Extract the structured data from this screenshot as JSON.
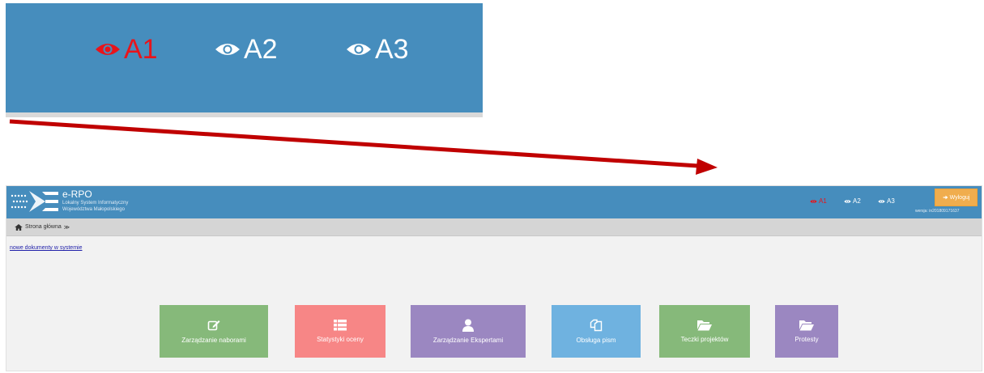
{
  "zoom_callout": {
    "accessibility_options": [
      {
        "label": "A1",
        "icon": "eye-icon",
        "active": true
      },
      {
        "label": "A2",
        "icon": "eye-icon",
        "active": false
      },
      {
        "label": "A3",
        "icon": "eye-icon",
        "active": false
      }
    ]
  },
  "header": {
    "app_title": "e-RPO",
    "app_subtitle_line1": "Lokalny System Informatyczny",
    "app_subtitle_line2": "Województwa Małopolskiego",
    "accessibility_options": [
      {
        "label": "A1",
        "icon": "eye-icon",
        "active": true
      },
      {
        "label": "A2",
        "icon": "eye-icon",
        "active": false
      },
      {
        "label": "A3",
        "icon": "eye-icon",
        "active": false
      }
    ],
    "logout_label": "Wyloguj",
    "version_text": "wersja: in201809171637"
  },
  "breadcrumb": {
    "home_label": "Strona główna",
    "separator": "≫"
  },
  "main": {
    "new_documents_link": "nowe dokumenty w systemie",
    "tiles": [
      {
        "label": "Zarządzanie naborami",
        "icon": "edit-icon",
        "color": "#86b97a"
      },
      {
        "label": "Statystyki oceny",
        "icon": "list-icon",
        "color": "#f78686"
      },
      {
        "label": "Zarządzanie Ekspertami",
        "icon": "user-icon",
        "color": "#9b87c1"
      },
      {
        "label": "Obsługa pism",
        "icon": "copy-icon",
        "color": "#6fb2e0"
      },
      {
        "label": "Teczki projektów",
        "icon": "folder-open-icon",
        "color": "#86b97a"
      },
      {
        "label": "Protesty",
        "icon": "folder-open-icon",
        "color": "#9b87c1"
      }
    ]
  },
  "colors": {
    "header_blue": "#468dbd",
    "active_red": "#e8141b",
    "arrow_red": "#c00000",
    "logout_orange": "#f0ad4e"
  }
}
